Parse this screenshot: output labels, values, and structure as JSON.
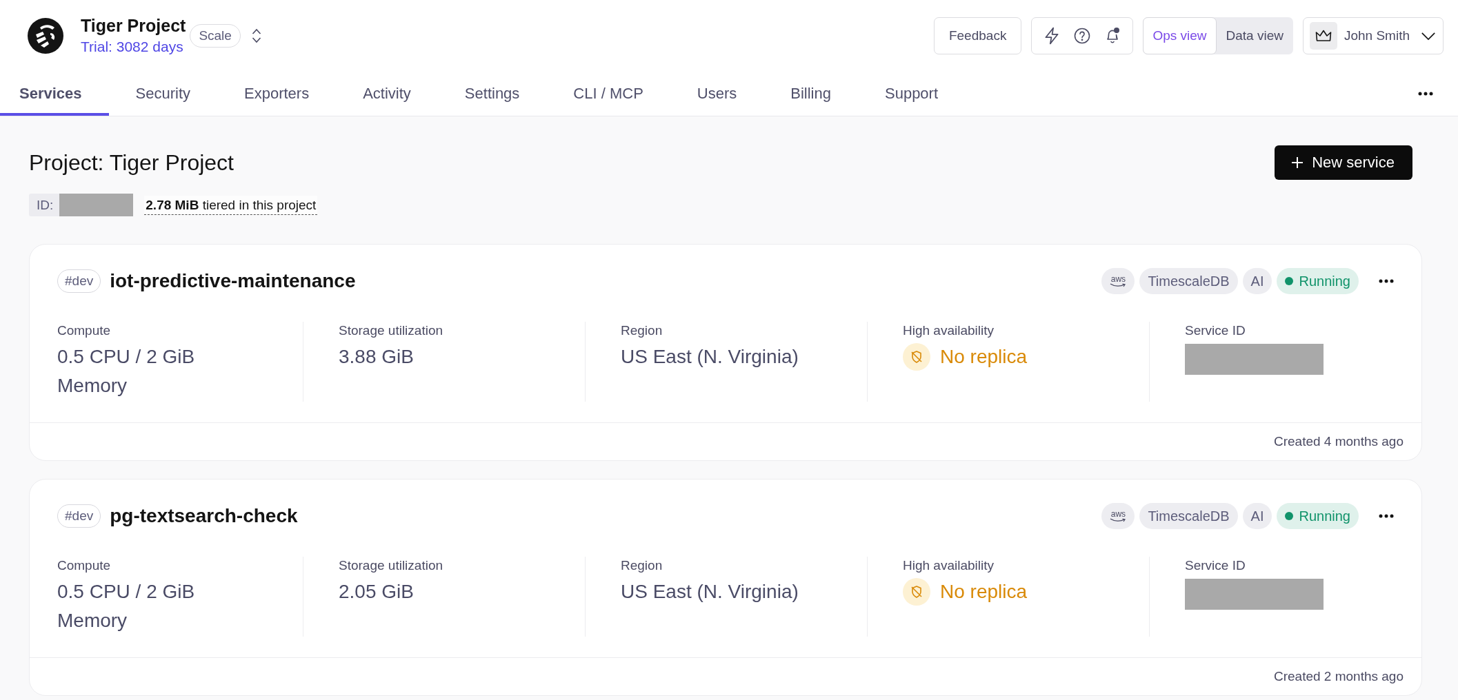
{
  "project_switcher": {
    "name": "Tiger Project",
    "trial": "Trial: 3082 days",
    "plan": "Scale"
  },
  "header_actions": {
    "feedback": "Feedback",
    "notifications_unread": true,
    "views": [
      {
        "label": "Ops view",
        "selected": true
      },
      {
        "label": "Data view",
        "selected": false
      }
    ],
    "user": "John Smith"
  },
  "tabs": [
    {
      "label": "Services",
      "selected": true
    },
    {
      "label": "Security",
      "selected": false
    },
    {
      "label": "Exporters",
      "selected": false
    },
    {
      "label": "Activity",
      "selected": false
    },
    {
      "label": "Settings",
      "selected": false
    },
    {
      "label": "CLI / MCP",
      "selected": false
    },
    {
      "label": "Users",
      "selected": false
    },
    {
      "label": "Billing",
      "selected": false
    },
    {
      "label": "Support",
      "selected": false
    }
  ],
  "project": {
    "title": "Project: Tiger Project",
    "id_label": "ID:",
    "tiered": "**2.78 MiB** tiered in this project",
    "new_service": "New service"
  },
  "services": [
    {
      "tag": "#dev",
      "name": "iot-predictive-maintenance",
      "badges": [
        {
          "kind": "provider",
          "label": "aws"
        },
        {
          "kind": "tag",
          "label": "TimescaleDB"
        },
        {
          "kind": "tag",
          "label": "AI"
        }
      ],
      "status": {
        "label": "Running",
        "color": "#10936a"
      },
      "metrics": [
        {
          "kind": "text",
          "label": "Compute",
          "value": "0.5 CPU / 2 GiB Memory"
        },
        {
          "kind": "text",
          "label": "Storage utilization",
          "value": "3.88 GiB"
        },
        {
          "kind": "text",
          "label": "Region",
          "value": "US East (N. Virginia)"
        },
        {
          "kind": "availability",
          "label": "High availability",
          "value": "No replica",
          "on": false
        },
        {
          "kind": "redacted",
          "label": "Service ID"
        }
      ],
      "created": "Created 4 months ago"
    },
    {
      "tag": "#dev",
      "name": "pg-textsearch-check",
      "badges": [
        {
          "kind": "provider",
          "label": "aws"
        },
        {
          "kind": "tag",
          "label": "TimescaleDB"
        },
        {
          "kind": "tag",
          "label": "AI"
        }
      ],
      "status": {
        "label": "Running",
        "color": "#10936a"
      },
      "metrics": [
        {
          "kind": "text",
          "label": "Compute",
          "value": "0.5 CPU / 2 GiB Memory"
        },
        {
          "kind": "text",
          "label": "Storage utilization",
          "value": "2.05 GiB"
        },
        {
          "kind": "text",
          "label": "Region",
          "value": "US East (N. Virginia)"
        },
        {
          "kind": "availability",
          "label": "High availability",
          "value": "No replica",
          "on": false
        },
        {
          "kind": "redacted",
          "label": "Service ID"
        }
      ],
      "created": "Created 2 months ago"
    }
  ]
}
